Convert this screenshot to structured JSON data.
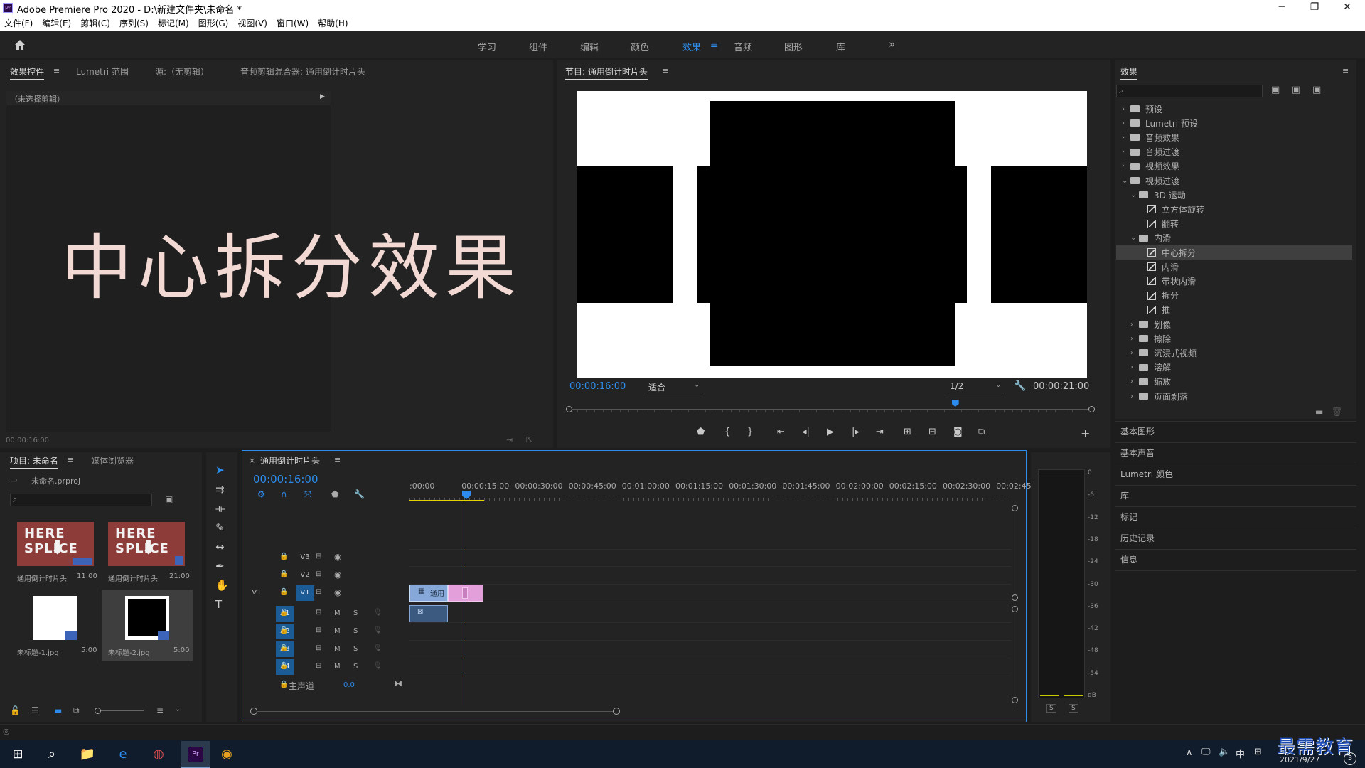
{
  "window": {
    "title": "Adobe Premiere Pro 2020 - D:\\新建文件夹\\未命名 *",
    "minimize": "─",
    "maximize": "❐",
    "close": "✕"
  },
  "menu": [
    "文件(F)",
    "编辑(E)",
    "剪辑(C)",
    "序列(S)",
    "标记(M)",
    "图形(G)",
    "视图(V)",
    "窗口(W)",
    "帮助(H)"
  ],
  "workspaces": {
    "tabs": [
      "学习",
      "组件",
      "编辑",
      "颜色",
      "效果",
      "音频",
      "图形",
      "库"
    ],
    "active": "效果",
    "more": "»",
    "menu_glyph": "≡"
  },
  "source_panel": {
    "tabs": [
      "效果控件",
      "Lumetri 范围",
      "源:（无剪辑）",
      "音频剪辑混合器: 通用倒计时片头"
    ],
    "tab_menu": "≡",
    "no_clip": "（未选择剪辑）",
    "timecode": "00:00:16:00",
    "overlay_text": "中心拆分效果"
  },
  "program_monitor": {
    "title": "节目: 通用倒计时片头",
    "menu": "≡",
    "current_time": "00:00:16:00",
    "fit": "适合",
    "resolution": "1/2",
    "duration": "00:00:21:00",
    "progress": 0.74,
    "transport": [
      "marker",
      "in-point",
      "out-point",
      "go-to-in",
      "step-back",
      "play",
      "step-forward",
      "go-to-out",
      "lift",
      "extract",
      "export-frame",
      "button-editor"
    ]
  },
  "effects_panel": {
    "title": "效果",
    "menu": "≡",
    "search_placeholder": "",
    "tree": [
      {
        "label": "预设",
        "kind": "folder",
        "expanded": false,
        "level": 0
      },
      {
        "label": "Lumetri 预设",
        "kind": "folder",
        "expanded": false,
        "level": 0
      },
      {
        "label": "音频效果",
        "kind": "folder",
        "expanded": false,
        "level": 0
      },
      {
        "label": "音频过渡",
        "kind": "folder",
        "expanded": false,
        "level": 0
      },
      {
        "label": "视频效果",
        "kind": "folder",
        "expanded": false,
        "level": 0
      },
      {
        "label": "视频过渡",
        "kind": "folder",
        "expanded": true,
        "level": 0
      },
      {
        "label": "3D 运动",
        "kind": "folder",
        "expanded": true,
        "level": 1
      },
      {
        "label": "立方体旋转",
        "kind": "effect",
        "level": 2
      },
      {
        "label": "翻转",
        "kind": "effect",
        "level": 2
      },
      {
        "label": "内滑",
        "kind": "folder",
        "expanded": true,
        "level": 1
      },
      {
        "label": "中心拆分",
        "kind": "effect",
        "level": 2,
        "selected": true
      },
      {
        "label": "内滑",
        "kind": "effect",
        "level": 2
      },
      {
        "label": "带状内滑",
        "kind": "effect",
        "level": 2
      },
      {
        "label": "拆分",
        "kind": "effect",
        "level": 2
      },
      {
        "label": "推",
        "kind": "effect",
        "level": 2
      },
      {
        "label": "划像",
        "kind": "folder",
        "expanded": false,
        "level": 1
      },
      {
        "label": "擦除",
        "kind": "folder",
        "expanded": false,
        "level": 1
      },
      {
        "label": "沉浸式视频",
        "kind": "folder",
        "expanded": false,
        "level": 1
      },
      {
        "label": "溶解",
        "kind": "folder",
        "expanded": false,
        "level": 1
      },
      {
        "label": "缩放",
        "kind": "folder",
        "expanded": false,
        "level": 1
      },
      {
        "label": "页面剥落",
        "kind": "folder",
        "expanded": false,
        "level": 1
      }
    ]
  },
  "side_panels": [
    "基本图形",
    "基本声音",
    "Lumetri 颜色",
    "库",
    "标记",
    "历史记录",
    "信息"
  ],
  "project_panel": {
    "tabs": [
      "项目: 未命名",
      "媒体浏览器"
    ],
    "menu": "≡",
    "file": "未命名.prproj",
    "items": [
      {
        "name": "通用倒计时片头",
        "duration": "11:00",
        "thumb_text": "HERE SPLICE"
      },
      {
        "name": "通用倒计时片头",
        "duration": "21:00",
        "thumb_text": "HERE SPLICE"
      },
      {
        "name": "未标题-1.jpg",
        "duration": "5:00"
      },
      {
        "name": "未标题-2.jpg",
        "duration": "5:00"
      }
    ]
  },
  "timeline": {
    "sequence": "通用倒计时片头",
    "close": "×",
    "menu": "≡",
    "timecode": "00:00:16:00",
    "ruler": [
      ":00:00",
      "00:00:15:00",
      "00:00:30:00",
      "00:00:45:00",
      "00:01:00:00",
      "00:01:15:00",
      "00:01:30:00",
      "00:01:45:00",
      "00:02:00:00",
      "00:02:15:00",
      "00:02:30:00",
      "00:02:45:"
    ],
    "video_tracks": [
      "V3",
      "V2",
      "V1"
    ],
    "audio_tracks": [
      "A1",
      "A2",
      "A3",
      "A4"
    ],
    "source_patch_video": "V1",
    "master": "主声道",
    "master_value": "0.0",
    "clip_label": "通用",
    "mute": "M",
    "solo": "S"
  },
  "audio_meter": {
    "scale": [
      "0",
      "-6",
      "-12",
      "-18",
      "-24",
      "-30",
      "-36",
      "-42",
      "-48",
      "-54",
      "dB"
    ],
    "solo_buttons": [
      "S",
      "S"
    ]
  },
  "taskbar": {
    "tray": "∧",
    "ime": "中",
    "date": "2021/9/27",
    "watermark": "最需教育"
  }
}
